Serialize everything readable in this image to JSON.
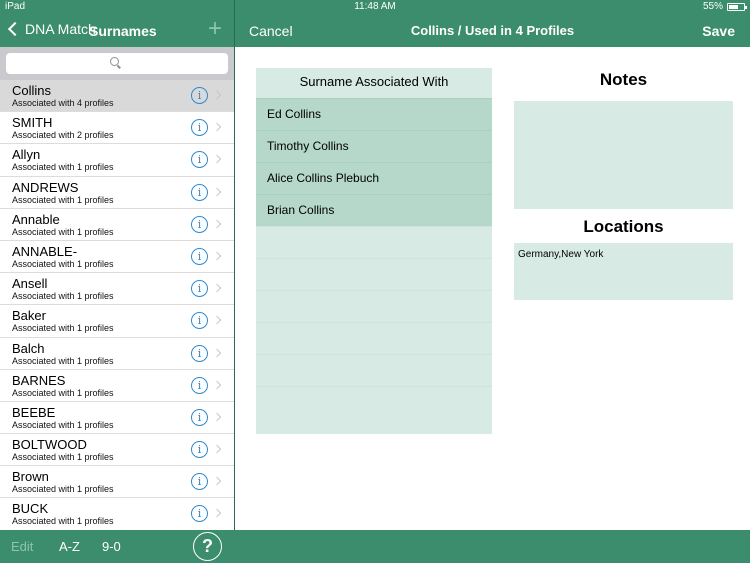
{
  "status": {
    "device": "iPad",
    "time": "11:48 AM",
    "battery": "55%",
    "battery_level": 0.55
  },
  "left_nav": {
    "back_label": "DNA Match",
    "title": "Surnames",
    "add_label": "+"
  },
  "search": {
    "placeholder": ""
  },
  "surnames": [
    {
      "name": "Collins",
      "sub": "Associated with 4 profiles",
      "selected": true
    },
    {
      "name": "SMITH",
      "sub": "Associated with 2 profiles"
    },
    {
      "name": "Allyn",
      "sub": "Associated with 1 profiles"
    },
    {
      "name": "ANDREWS",
      "sub": "Associated with 1 profiles"
    },
    {
      "name": "Annable",
      "sub": "Associated with 1 profiles"
    },
    {
      "name": "ANNABLE-",
      "sub": "Associated with 1 profiles"
    },
    {
      "name": "Ansell",
      "sub": "Associated with 1 profiles"
    },
    {
      "name": "Baker",
      "sub": "Associated with 1 profiles"
    },
    {
      "name": "Balch",
      "sub": "Associated with 1 profiles"
    },
    {
      "name": "BARNES",
      "sub": "Associated with 1 profiles"
    },
    {
      "name": "BEEBE",
      "sub": "Associated with 1 profiles"
    },
    {
      "name": "BOLTWOOD",
      "sub": "Associated with 1 profiles"
    },
    {
      "name": "Brown",
      "sub": "Associated with 1 profiles"
    },
    {
      "name": "BUCK",
      "sub": "Associated with 1 profiles"
    }
  ],
  "right_nav": {
    "cancel": "Cancel",
    "title": "Collins / Used in 4 Profiles",
    "save": "Save"
  },
  "associated": {
    "header": "Surname Associated With",
    "rows": [
      "Ed Collins",
      "Timothy Collins",
      "Alice Collins Plebuch",
      "Brian Collins",
      "",
      "",
      "",
      "",
      "",
      ""
    ]
  },
  "notes": {
    "title": "Notes",
    "value": ""
  },
  "locations": {
    "title": "Locations",
    "value": "Germany,New York"
  },
  "toolbar": {
    "edit": "Edit",
    "az": "A-Z",
    "num": "9-0",
    "help": "?"
  },
  "colors": {
    "bar": "#3b8d6d",
    "panel": "#d7ebe4",
    "panel_filled": "#b5d8cb",
    "info": "#2f8ad1"
  }
}
